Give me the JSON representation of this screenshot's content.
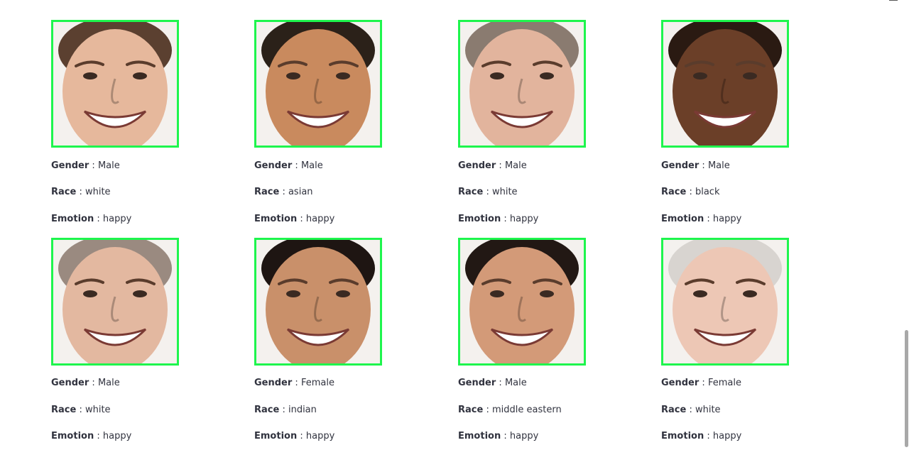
{
  "faces": [
    {
      "tone": "#e6b89c",
      "hair": "#5b4030",
      "gender_label": "Gender",
      "gender": "Male",
      "race_label": "Race",
      "race": "white",
      "emotion_label": "Emotion",
      "emotion": "happy"
    },
    {
      "tone": "#c98a5e",
      "hair": "#2b2119",
      "gender_label": "Gender",
      "gender": "Male",
      "race_label": "Race",
      "race": "asian",
      "emotion_label": "Emotion",
      "emotion": "happy"
    },
    {
      "tone": "#e2b49d",
      "hair": "#8a7b70",
      "gender_label": "Gender",
      "gender": "Male",
      "race_label": "Race",
      "race": "white",
      "emotion_label": "Emotion",
      "emotion": "happy"
    },
    {
      "tone": "#6b3f28",
      "hair": "#2a1a12",
      "gender_label": "Gender",
      "gender": "Male",
      "race_label": "Race",
      "race": "black",
      "emotion_label": "Emotion",
      "emotion": "happy"
    },
    {
      "tone": "#e3b8a0",
      "hair": "#9a8a80",
      "gender_label": "Gender",
      "gender": "Male",
      "race_label": "Race",
      "race": "white",
      "emotion_label": "Emotion",
      "emotion": "happy"
    },
    {
      "tone": "#c9906a",
      "hair": "#1e1512",
      "gender_label": "Gender",
      "gender": "Female",
      "race_label": "Race",
      "race": "indian",
      "emotion_label": "Emotion",
      "emotion": "happy"
    },
    {
      "tone": "#d39a78",
      "hair": "#221814",
      "gender_label": "Gender",
      "gender": "Male",
      "race_label": "Race",
      "race": "middle eastern",
      "emotion_label": "Emotion",
      "emotion": "happy"
    },
    {
      "tone": "#edc7b5",
      "hair": "#d8d4d0",
      "gender_label": "Gender",
      "gender": "Female",
      "race_label": "Race",
      "race": "white",
      "emotion_label": "Emotion",
      "emotion": "happy"
    }
  ],
  "colors": {
    "border": "#1ef54d",
    "text": "#31333f"
  }
}
